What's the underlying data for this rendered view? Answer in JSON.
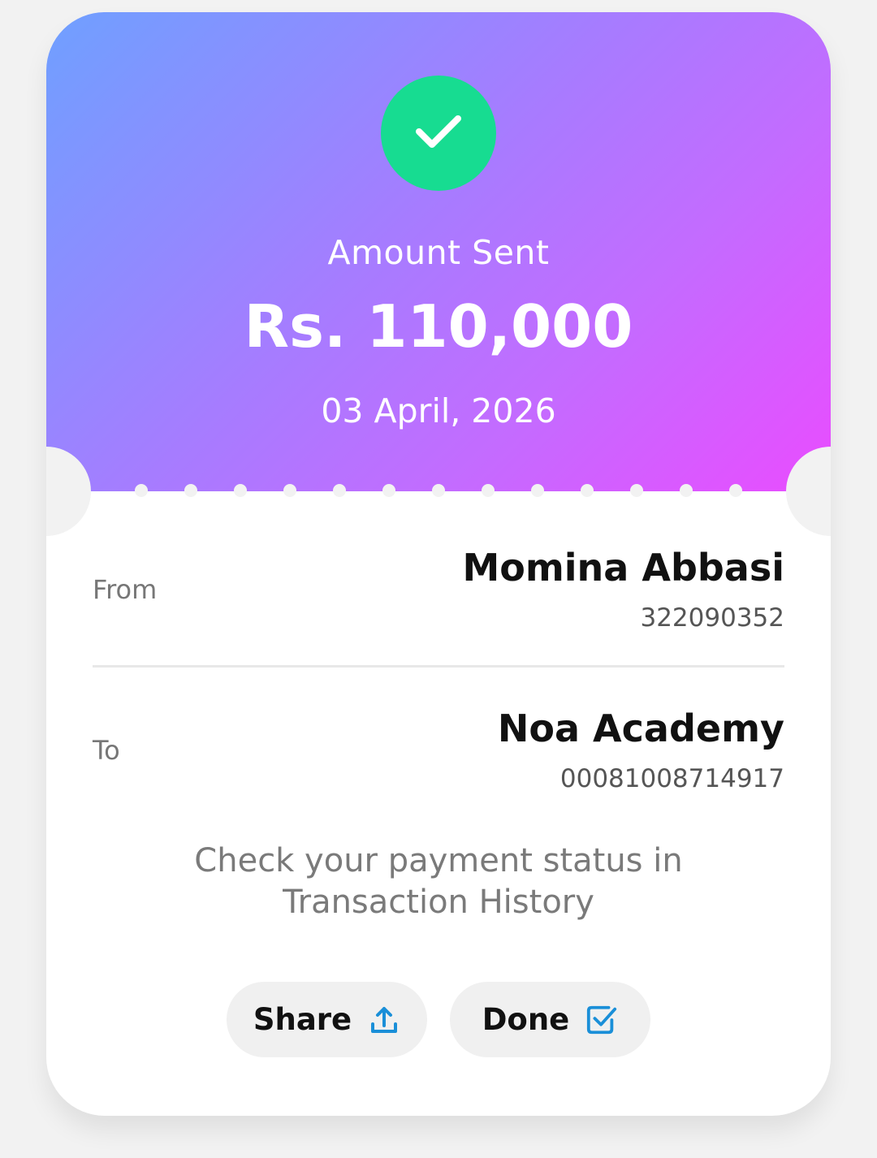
{
  "receipt": {
    "heading": "Amount Sent",
    "amount": "Rs. 110,000",
    "date": "03 April, 2026",
    "status_color": "#17dc91",
    "gradient_colors": [
      "#6fa0ff",
      "#a67cff",
      "#e94cff"
    ]
  },
  "from": {
    "label": "From",
    "name": "Momina Abbasi",
    "account": "322090352"
  },
  "to": {
    "label": "To",
    "name": "Noa Academy",
    "account": "00081008714917"
  },
  "status_message": "Check your payment status in Transaction History",
  "actions": {
    "share_label": "Share",
    "share_icon": "upload-icon",
    "done_label": "Done",
    "done_icon": "check-box-icon",
    "icon_color": "#1a8fd8"
  }
}
